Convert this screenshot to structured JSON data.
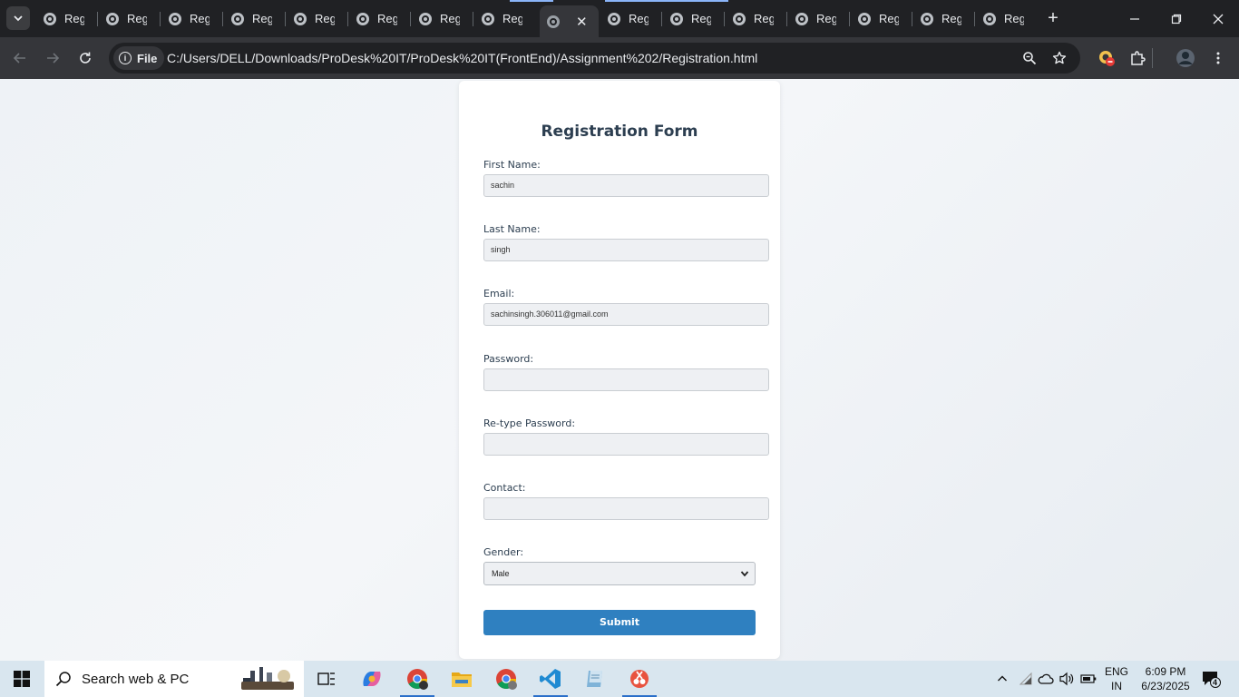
{
  "browser": {
    "tab_title": "Regi",
    "tabs_count_label": "",
    "url_scheme_label": "File",
    "url": "C:/Users/DELL/Downloads/ProDesk%20IT/ProDesk%20IT(FrontEnd)/Assignment%202/Registration.html"
  },
  "form": {
    "title": "Registration Form",
    "fields": [
      {
        "label": "First Name:",
        "value": "sachin"
      },
      {
        "label": "Last Name:",
        "value": "singh"
      },
      {
        "label": "Email:",
        "value": "sachinsingh.306011@gmail.com"
      },
      {
        "label": "Password:",
        "value": ""
      },
      {
        "label": "Re-type Password:",
        "value": ""
      },
      {
        "label": "Contact:",
        "value": ""
      }
    ],
    "gender": {
      "label": "Gender:",
      "selected": "Male"
    },
    "submit_label": "Submit"
  },
  "taskbar": {
    "search_placeholder": "Search web & PC",
    "lang_line1": "ENG",
    "lang_line2": "IN",
    "time": "6:09 PM",
    "date": "6/23/2025",
    "notification_count": "4"
  },
  "colors": {
    "accent": "#2f80c0",
    "title": "#2c3e50",
    "chrome_dark": "#202124"
  }
}
